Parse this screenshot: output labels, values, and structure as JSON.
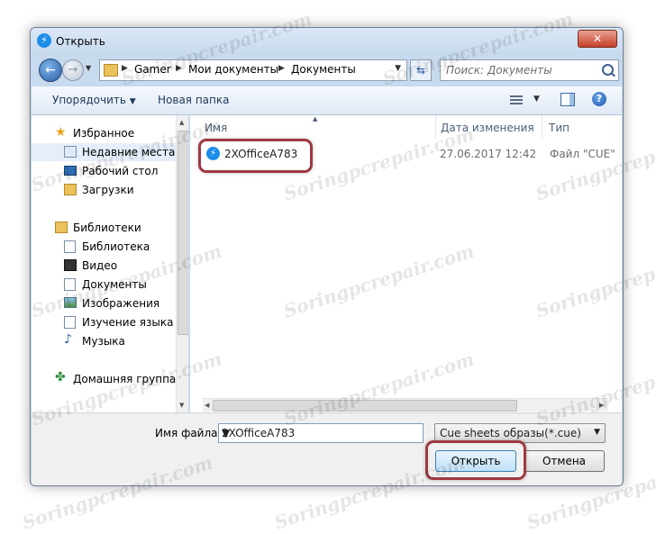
{
  "window": {
    "title": "Открыть"
  },
  "address": {
    "crumbs": [
      "Gamer",
      "Мои документы",
      "Документы"
    ]
  },
  "search": {
    "placeholder": "Поиск: Документы"
  },
  "toolbar": {
    "organize": "Упорядочить",
    "new_folder": "Новая папка"
  },
  "nav": {
    "favorites_header": "Избранное",
    "favorites": [
      "Недавние места",
      "Рабочий стол",
      "Загрузки"
    ],
    "libraries_header": "Библиотеки",
    "libraries": [
      "Библиотека",
      "Видео",
      "Документы",
      "Изображения",
      "Изучение языка",
      "Музыка"
    ],
    "homegroup": "Домашняя группа"
  },
  "columns": {
    "name": "Имя",
    "date": "Дата изменения",
    "type": "Тип"
  },
  "files": [
    {
      "name": "2XOfficeA783",
      "date": "27.06.2017 12:42",
      "type": "Файл \"CUE\""
    }
  ],
  "bottom": {
    "filename_label": "Имя файла:",
    "filename_value": "2XOfficeA783",
    "filter_value": "Cue sheets образы(*.cue)",
    "open_label": "Открыть",
    "cancel_label": "Отмена"
  },
  "watermark": "Soringpcrepair.com",
  "colors": {
    "highlight": "#9f3842",
    "window_frame": "#c7daee",
    "accent": "#1c8de8"
  }
}
